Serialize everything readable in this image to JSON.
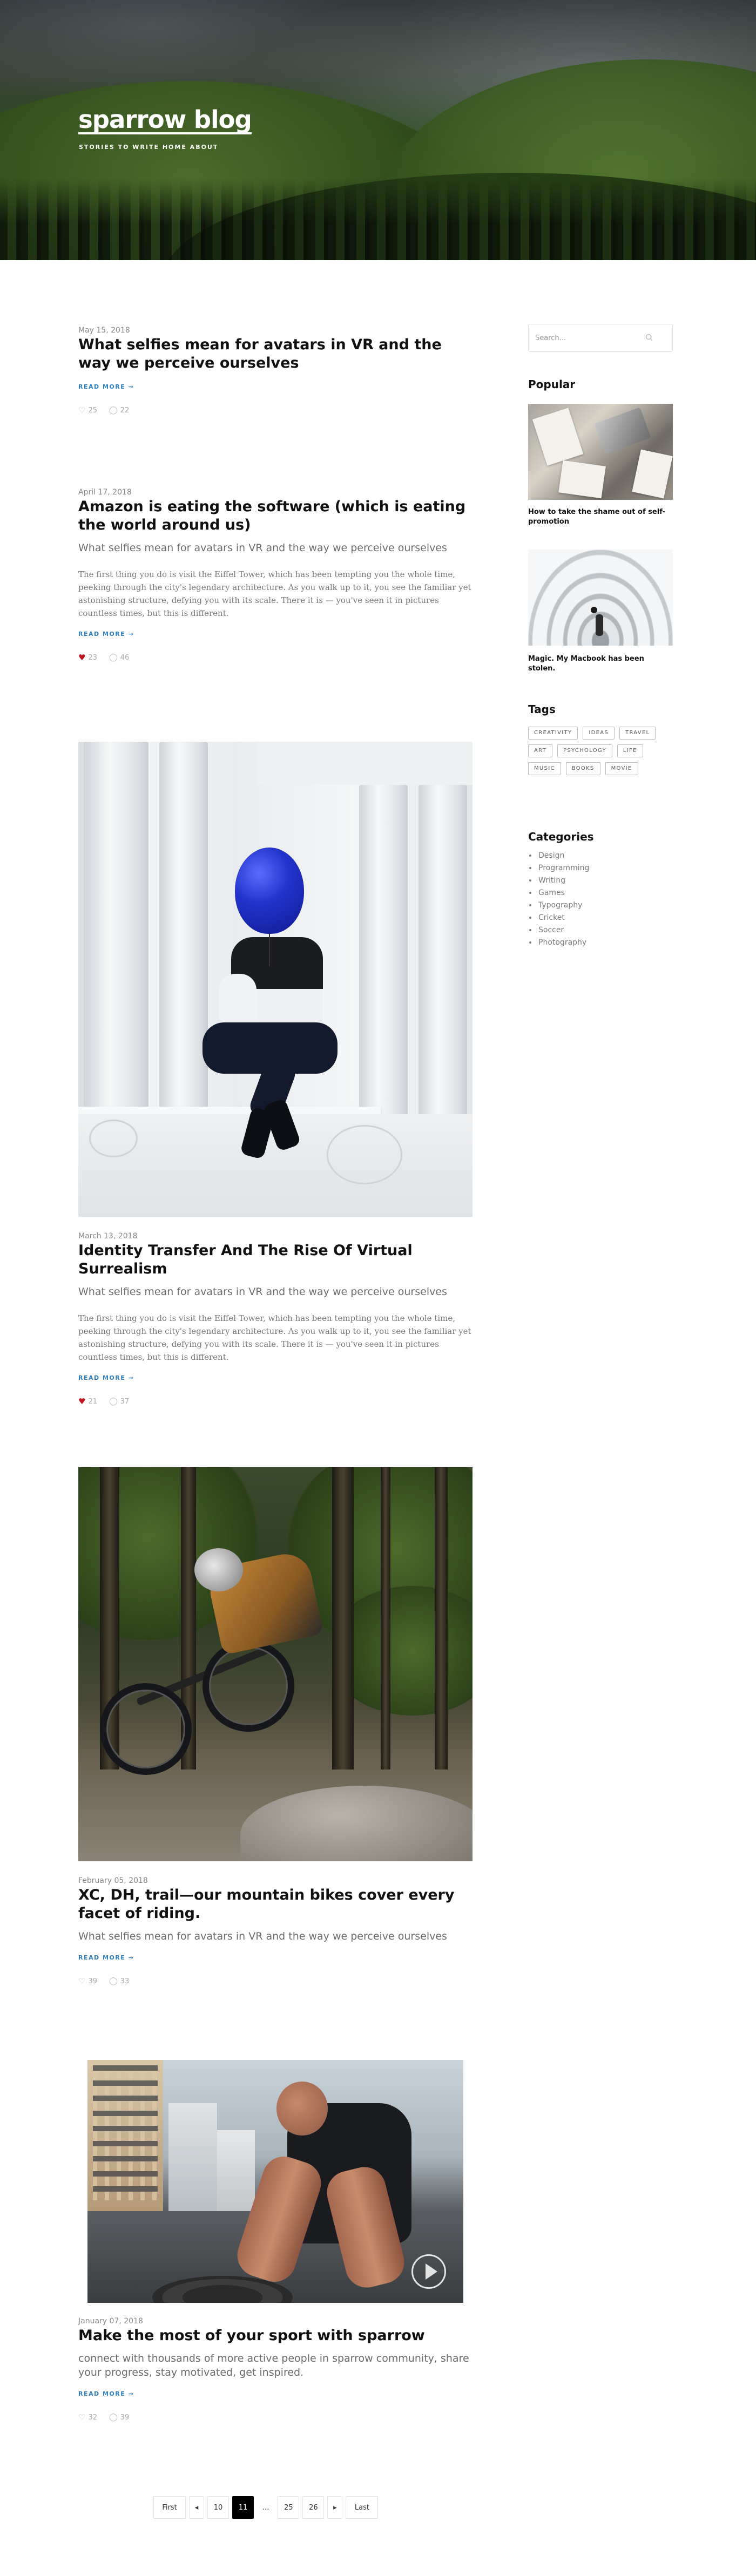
{
  "header": {
    "logo": "sparrow blog",
    "tagline": "STORIES TO WRITE HOME ABOUT"
  },
  "posts": [
    {
      "date": "May 15, 2018",
      "title": "What selfies mean for avatars in VR and the way we perceive ourselves",
      "read_more": "READ MORE →",
      "likes": "25",
      "comments": "22",
      "liked": false
    },
    {
      "date": "April 17, 2018",
      "title": "Amazon is eating the software (which is eating the world around us)",
      "subtitle": "What selfies mean for avatars in VR and the way we perceive ourselves",
      "excerpt": "The first thing you do is visit the Eiffel Tower, which has been tempting you the whole time, peeking through the city's legendary architecture. As you walk up to it, you see the familiar yet astonishing structure, defying you with its scale. There it is — you've seen it in pictures countless times, but this is different.",
      "read_more": "READ MORE →",
      "likes": "23",
      "comments": "46",
      "liked": true
    },
    {
      "date": "March 13, 2018",
      "title": "Identity Transfer And The Rise Of Virtual Surrealism",
      "subtitle": "What selfies mean for avatars in VR and the way we perceive ourselves",
      "excerpt": "The first thing you do is visit the Eiffel Tower, which has been tempting you the whole time, peeking through the city's legendary architecture. As you walk up to it, you see the familiar yet astonishing structure, defying you with its scale. There it is — you've seen it in pictures countless times, but this is different.",
      "read_more": "READ MORE →",
      "likes": "21",
      "comments": "37",
      "liked": true
    },
    {
      "date": "February 05, 2018",
      "title": "XC, DH, trail—our mountain bikes cover every facet of riding.",
      "subtitle": "What selfies mean for avatars in VR and the way we perceive ourselves",
      "read_more": "READ MORE →",
      "likes": "39",
      "comments": "33",
      "liked": false
    },
    {
      "date": "January 07, 2018",
      "title": "Make the most of your sport with sparrow",
      "subtitle": "connect with thousands of more active people in sparrow community, share your progress, stay motivated, get inspired.",
      "read_more": "READ MORE →",
      "likes": "32",
      "comments": "39",
      "liked": false
    }
  ],
  "sidebar": {
    "search_placeholder": "Search...",
    "popular_title": "Popular",
    "popular": [
      "How to take the shame out of self-promotion",
      "Magic. My Macbook has been stolen."
    ],
    "tags_title": "Tags",
    "tags": [
      "CREATIVITY",
      "IDEAS",
      "TRAVEL",
      "ART",
      "PSYCHOLOGY",
      "LIFE",
      "MUSIC",
      "BOOKS",
      "MOVIE"
    ],
    "categories_title": "Categories",
    "categories": [
      "Design",
      "Programming",
      "Writing",
      "Games",
      "Typography",
      "Cricket",
      "Soccer",
      "Photography"
    ]
  },
  "pagination": {
    "first": "First",
    "prev_icon": "caret-left-icon",
    "pages": [
      "10",
      "11",
      "...",
      "25",
      "26"
    ],
    "current": "11",
    "next_icon": "caret-right-icon",
    "last": "Last"
  },
  "colors": {
    "accent": "#2e7fbf",
    "heart": "#c1121f",
    "active_page": "#000000"
  }
}
